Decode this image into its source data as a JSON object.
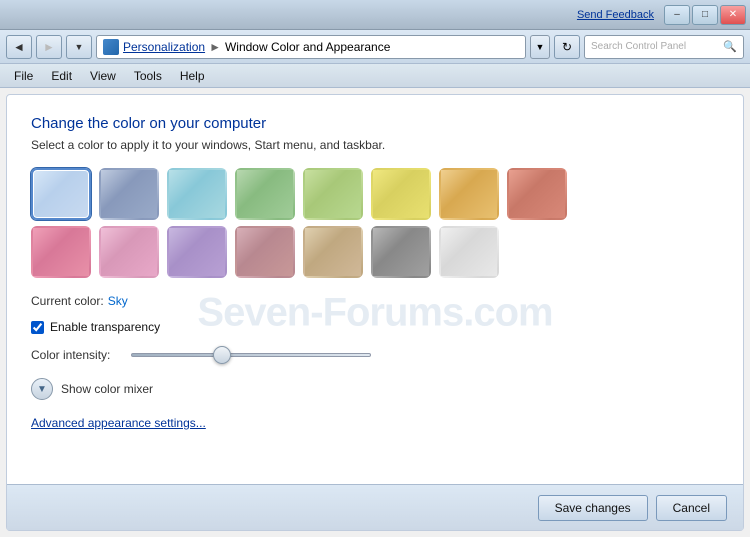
{
  "titlebar": {
    "send_feedback": "Send Feedback",
    "minimize_label": "–",
    "maximize_label": "□",
    "close_label": "✕"
  },
  "addressbar": {
    "breadcrumb_icon_alt": "control-panel-icon",
    "breadcrumb_root": "Personalization",
    "breadcrumb_sep": "►",
    "breadcrumb_current": "Window Color and Appearance",
    "search_placeholder": "Search Control Panel",
    "refresh_icon": "↻",
    "back_icon": "◄",
    "dropdown_icon": "▼",
    "search_icon": "🔍"
  },
  "menubar": {
    "items": [
      {
        "label": "File"
      },
      {
        "label": "Edit"
      },
      {
        "label": "View"
      },
      {
        "label": "Tools"
      },
      {
        "label": "Help"
      }
    ]
  },
  "main": {
    "title": "Change the color on your computer",
    "subtitle": "Select a color to apply it to your windows, Start menu, and taskbar.",
    "watermark": "Seven-Forums.com",
    "current_color_label": "Current color:",
    "current_color_value": "Sky",
    "transparency_label": "Enable transparency",
    "intensity_label": "Color intensity:",
    "show_mixer_label": "Show color mixer",
    "advanced_link": "Advanced appearance settings...",
    "swatches_row1": [
      {
        "name": "Sky",
        "class": "swatch-sky",
        "selected": true
      },
      {
        "name": "Twilight",
        "class": "swatch-twilight",
        "selected": false
      },
      {
        "name": "Sea foam",
        "class": "swatch-seafoam",
        "selected": false
      },
      {
        "name": "Leaf",
        "class": "swatch-leaf",
        "selected": false
      },
      {
        "name": "Lime",
        "class": "swatch-lime",
        "selected": false
      },
      {
        "name": "Citrus",
        "class": "swatch-citrus",
        "selected": false
      },
      {
        "name": "Gold",
        "class": "swatch-gold",
        "selected": false
      },
      {
        "name": "Dusk",
        "class": "swatch-dusk",
        "selected": false
      }
    ],
    "swatches_row2": [
      {
        "name": "Pink",
        "class": "swatch-pink",
        "selected": false
      },
      {
        "name": "Blush",
        "class": "swatch-blush",
        "selected": false
      },
      {
        "name": "Violet",
        "class": "swatch-violet",
        "selected": false
      },
      {
        "name": "Rose",
        "class": "swatch-rose",
        "selected": false
      },
      {
        "name": "Tan",
        "class": "swatch-tan",
        "selected": false
      },
      {
        "name": "Storm",
        "class": "swatch-storm",
        "selected": false
      },
      {
        "name": "Frost",
        "class": "swatch-frost",
        "selected": false
      }
    ]
  },
  "footer": {
    "save_label": "Save changes",
    "cancel_label": "Cancel"
  }
}
